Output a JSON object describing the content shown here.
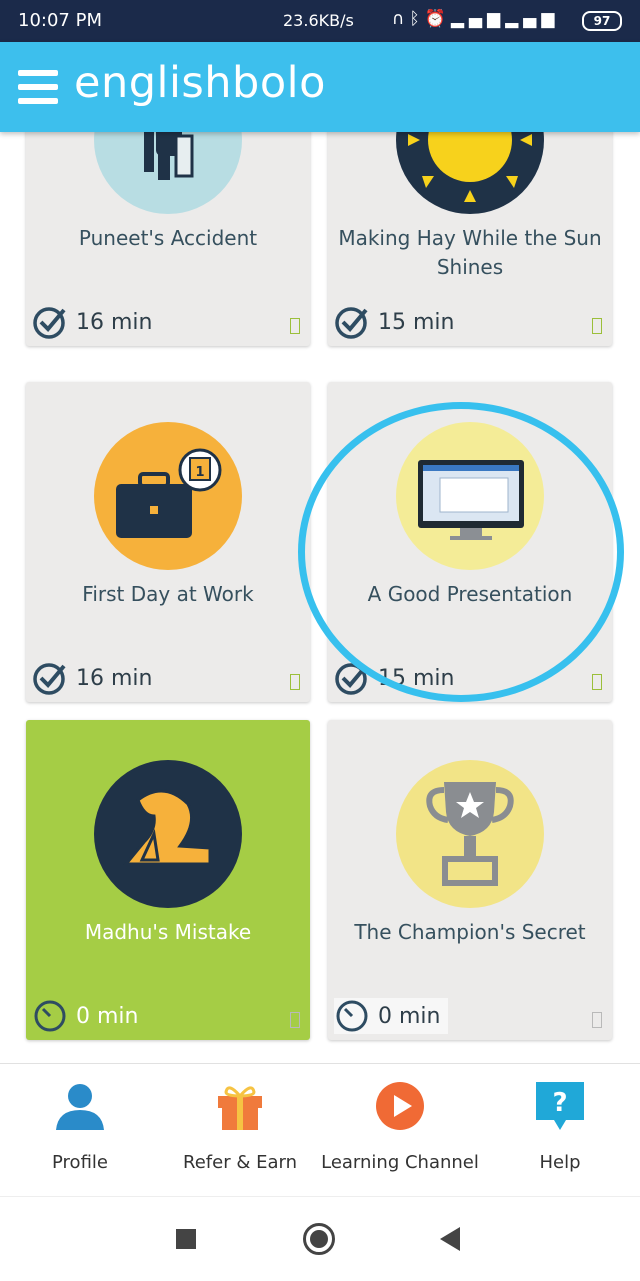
{
  "status_bar": {
    "time": "10:07 PM",
    "network_speed": "23.6KB/s",
    "battery": "97"
  },
  "app": {
    "brand": "englishbolo"
  },
  "lessons": [
    {
      "title": "Puneet's Accident",
      "duration": "16 min",
      "icon": "crutches-man-icon"
    },
    {
      "title": "Making Hay While the Sun Shines",
      "duration": "15 min",
      "icon": "sun-icon"
    },
    {
      "title": "First Day at Work",
      "duration": "16 min",
      "icon": "briefcase-calendar-icon"
    },
    {
      "title": "A Good Presentation",
      "duration": "15 min",
      "icon": "monitor-icon",
      "highlighted": true
    },
    {
      "title": "Madhu's Mistake",
      "duration": "0 min",
      "icon": "facepalm-icon",
      "selected": true
    },
    {
      "title": "The Champion's Secret",
      "duration": "0 min",
      "icon": "trophy-icon"
    }
  ],
  "bottom_nav": [
    {
      "label": "Profile",
      "icon": "profile-icon"
    },
    {
      "label": "Refer & Earn",
      "icon": "gift-icon"
    },
    {
      "label": "Learning Channel",
      "icon": "play-icon"
    },
    {
      "label": "Help",
      "icon": "help-icon"
    }
  ],
  "colors": {
    "status_bar": "#1b2a4a",
    "app_bar": "#3dbfed",
    "card": "#ecebea",
    "card_selected": "#a5cd45",
    "highlight_ring": "#37c0ee"
  }
}
